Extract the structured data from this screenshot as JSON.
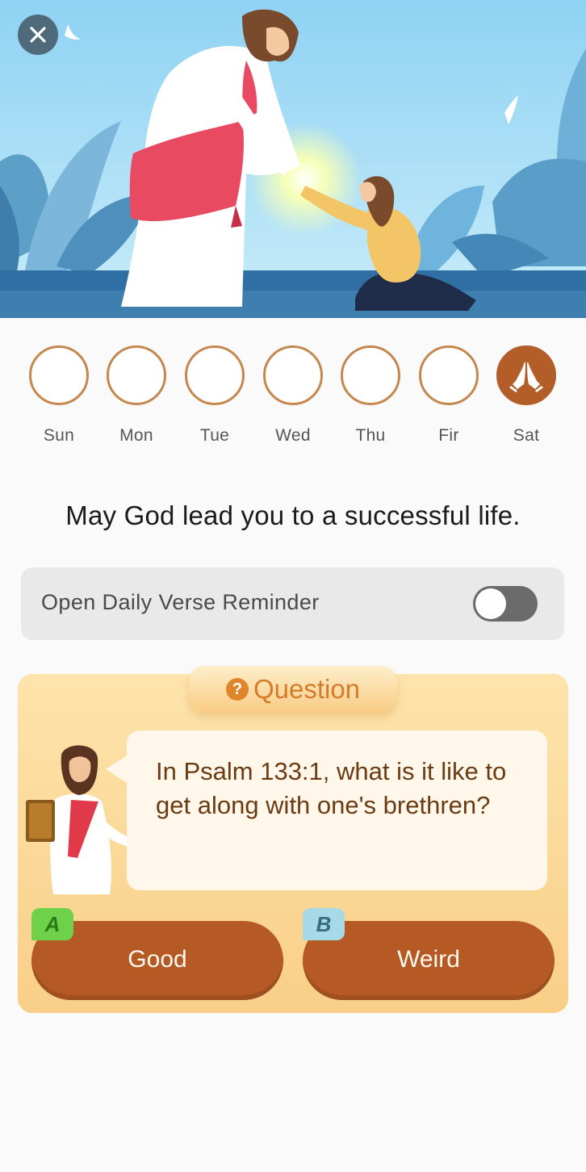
{
  "week": {
    "days": [
      {
        "label": "Sun",
        "checked": false
      },
      {
        "label": "Mon",
        "checked": false
      },
      {
        "label": "Tue",
        "checked": false
      },
      {
        "label": "Wed",
        "checked": false
      },
      {
        "label": "Thu",
        "checked": false
      },
      {
        "label": "Fir",
        "checked": false
      },
      {
        "label": "Sat",
        "checked": true,
        "icon": "praying-hands-icon"
      }
    ]
  },
  "blessing": "May God lead you to a successful life.",
  "reminder": {
    "label": "Open Daily Verse Reminder",
    "enabled": false
  },
  "quiz": {
    "tab_label": "Question",
    "question": "In Psalm 133:1, what is it like to get along with one's brethren?",
    "answers": [
      {
        "letter": "A",
        "label": "Good"
      },
      {
        "letter": "B",
        "label": "Weird"
      }
    ]
  },
  "colors": {
    "accent": "#b65a25",
    "ring": "#c4884f",
    "quiz_bg": "#f9cf88",
    "question_text": "#6b3c14"
  },
  "icons": [
    "close-icon",
    "praying-hands-icon",
    "question-icon"
  ]
}
